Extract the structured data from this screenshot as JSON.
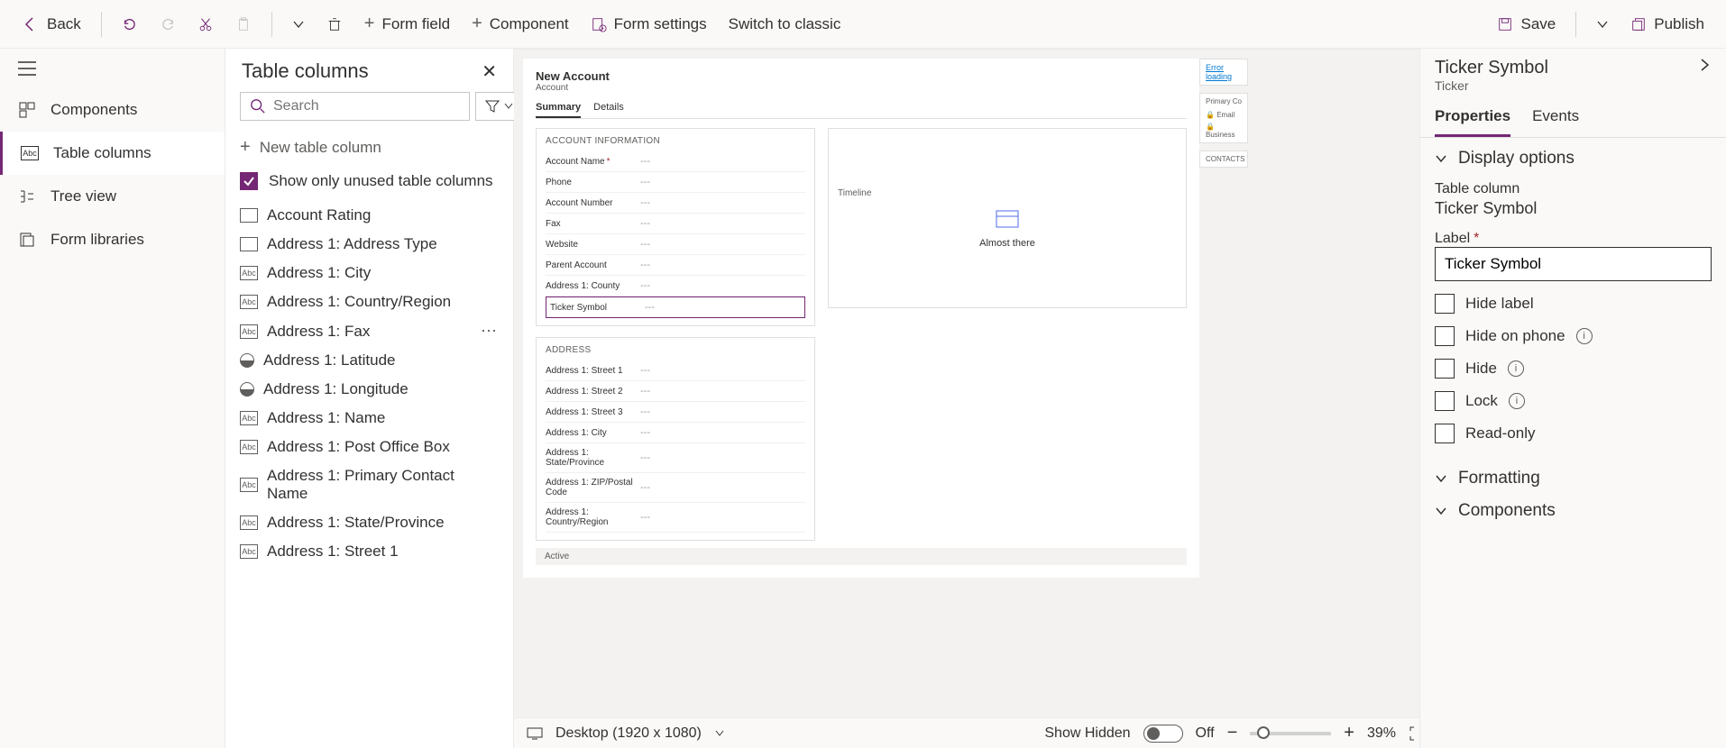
{
  "toolbar": {
    "back": "Back",
    "form_field": "Form field",
    "component": "Component",
    "form_settings": "Form settings",
    "switch_classic": "Switch to classic",
    "save": "Save",
    "publish": "Publish"
  },
  "rail": {
    "items": [
      {
        "label": "Components",
        "icon": "components"
      },
      {
        "label": "Table columns",
        "icon": "table-columns"
      },
      {
        "label": "Tree view",
        "icon": "tree"
      },
      {
        "label": "Form libraries",
        "icon": "libraries"
      }
    ]
  },
  "columns_panel": {
    "title": "Table columns",
    "search_placeholder": "Search",
    "new_column": "New table column",
    "show_unused": "Show only unused table columns",
    "items": [
      {
        "label": "Account Rating",
        "type": "option"
      },
      {
        "label": "Address 1: Address Type",
        "type": "option"
      },
      {
        "label": "Address 1: City",
        "type": "text"
      },
      {
        "label": "Address 1: Country/Region",
        "type": "text"
      },
      {
        "label": "Address 1: Fax",
        "type": "text",
        "hover": true
      },
      {
        "label": "Address 1: Latitude",
        "type": "float"
      },
      {
        "label": "Address 1: Longitude",
        "type": "float"
      },
      {
        "label": "Address 1: Name",
        "type": "text"
      },
      {
        "label": "Address 1: Post Office Box",
        "type": "text"
      },
      {
        "label": "Address 1: Primary Contact Name",
        "type": "text"
      },
      {
        "label": "Address 1: State/Province",
        "type": "text"
      },
      {
        "label": "Address 1: Street 1",
        "type": "text"
      }
    ]
  },
  "form_preview": {
    "title": "New Account",
    "entity": "Account",
    "tabs": [
      "Summary",
      "Details"
    ],
    "sections": {
      "account_info": {
        "title": "ACCOUNT INFORMATION",
        "fields": [
          {
            "label": "Account Name",
            "required": true
          },
          {
            "label": "Phone"
          },
          {
            "label": "Account Number"
          },
          {
            "label": "Fax"
          },
          {
            "label": "Website"
          },
          {
            "label": "Parent Account"
          },
          {
            "label": "Address 1: County"
          },
          {
            "label": "Ticker Symbol",
            "selected": true
          }
        ]
      },
      "address": {
        "title": "ADDRESS",
        "fields": [
          {
            "label": "Address 1: Street 1"
          },
          {
            "label": "Address 1: Street 2"
          },
          {
            "label": "Address 1: Street 3"
          },
          {
            "label": "Address 1: City"
          },
          {
            "label": "Address 1: State/Province"
          },
          {
            "label": "Address 1: ZIP/Postal Code"
          },
          {
            "label": "Address 1: Country/Region"
          }
        ]
      },
      "timeline": {
        "title": "Timeline",
        "status": "Almost there"
      }
    },
    "side_cards": {
      "error": "Error loading",
      "primary": "Primary Co",
      "email": "Email",
      "business": "Business",
      "contacts": "CONTACTS"
    },
    "status_bar": "Active"
  },
  "bottom_bar": {
    "device": "Desktop (1920 x 1080)",
    "show_hidden": "Show Hidden",
    "toggle_state": "Off",
    "zoom": "39%"
  },
  "props": {
    "title": "Ticker Symbol",
    "subtitle": "Ticker",
    "tabs": [
      "Properties",
      "Events"
    ],
    "section_display": "Display options",
    "table_column_label": "Table column",
    "table_column_value": "Ticker Symbol",
    "label_label": "Label",
    "label_value": "Ticker Symbol",
    "checks": [
      {
        "label": "Hide label"
      },
      {
        "label": "Hide on phone",
        "info": true
      },
      {
        "label": "Hide",
        "info": true
      },
      {
        "label": "Lock",
        "info": true
      },
      {
        "label": "Read-only"
      }
    ],
    "section_formatting": "Formatting",
    "section_components": "Components"
  }
}
